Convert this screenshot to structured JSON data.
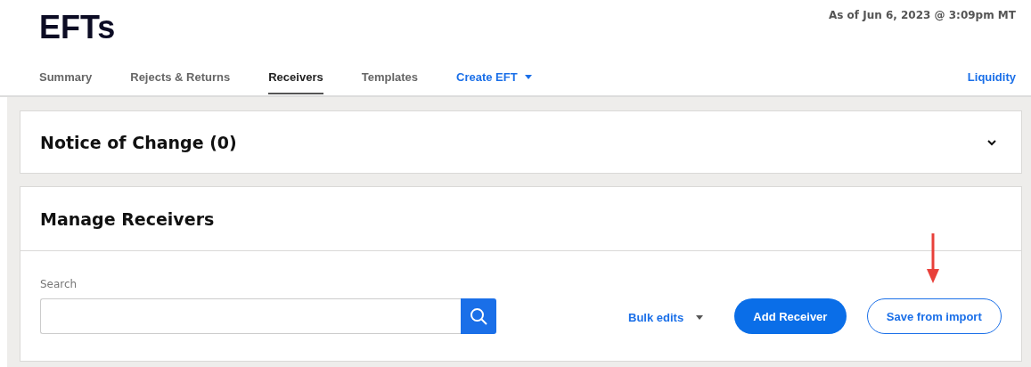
{
  "page": {
    "title": "EFTs",
    "timestamp": "As of Jun 6, 2023 @ 3:09pm MT"
  },
  "tabs": [
    {
      "label": "Summary",
      "kind": "tab",
      "selected": false
    },
    {
      "label": "Rejects & Returns",
      "kind": "tab",
      "selected": false
    },
    {
      "label": "Receivers",
      "kind": "tab",
      "selected": true
    },
    {
      "label": "Templates",
      "kind": "tab",
      "selected": false
    },
    {
      "label": "Create EFT",
      "kind": "dropdown",
      "selected": false
    }
  ],
  "side_link": "Liquidity",
  "notice_panel": {
    "title": "Notice of Change (0)",
    "expanded": false
  },
  "manage_panel": {
    "title": "Manage Receivers",
    "search": {
      "label": "Search"
    },
    "bulk_edits": "Bulk edits",
    "buttons": [
      {
        "label": "Add Receiver",
        "kind": "primary"
      },
      {
        "label": "Save from import",
        "kind": "outline"
      }
    ]
  }
}
